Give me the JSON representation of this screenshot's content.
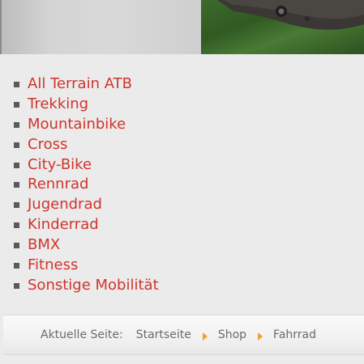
{
  "banner": {
    "image_icon": "bike-photo-icon"
  },
  "categories": [
    {
      "label": "All Terrain ATB"
    },
    {
      "label": "Trekking"
    },
    {
      "label": "Mountainbike"
    },
    {
      "label": "Cross"
    },
    {
      "label": "City-Bike"
    },
    {
      "label": "Rennrad"
    },
    {
      "label": "Jugendrad"
    },
    {
      "label": "Kinderrad"
    },
    {
      "label": "BMX"
    },
    {
      "label": "Fitness"
    },
    {
      "label": "Sonstige Mobilität"
    }
  ],
  "breadcrumb": {
    "prefix": "Aktuelle Seite:",
    "items": [
      {
        "label": "Startseite"
      },
      {
        "label": "Shop"
      },
      {
        "label": "Fahrrad"
      }
    ],
    "separator_icon": "orange-triangle-arrow-icon"
  },
  "colors": {
    "link": "#d0342c",
    "bullet": "#5a5a5a",
    "separator": "#f0a030",
    "background": "#ebebeb"
  }
}
